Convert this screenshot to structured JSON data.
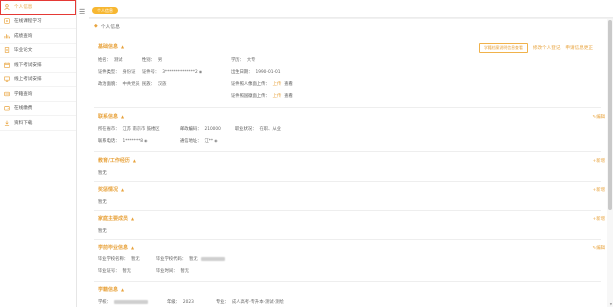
{
  "sidebar": {
    "items": [
      {
        "label": "个人信息",
        "icon": "person-icon"
      },
      {
        "label": "在线课程学习",
        "icon": "play-icon"
      },
      {
        "label": "成绩查询",
        "icon": "chart-icon"
      },
      {
        "label": "毕业论文",
        "icon": "document-icon"
      },
      {
        "label": "线下考试安排",
        "icon": "calendar-icon"
      },
      {
        "label": "线上考试安排",
        "icon": "monitor-icon"
      },
      {
        "label": "学籍查询",
        "icon": "id-card-icon"
      },
      {
        "label": "在线缴费",
        "icon": "wallet-icon"
      },
      {
        "label": "资料下载",
        "icon": "download-icon"
      }
    ]
  },
  "topbar": {
    "tag": "个人信息"
  },
  "breadcrumb": "个人信息",
  "actions": {
    "outline_btn": "学籍档案说明信息查看",
    "modify_personal": "修改个人登记",
    "apply_correction": "申请信息更正"
  },
  "basic": {
    "title": "基础信息",
    "name_label": "姓名：",
    "name_value": "测试",
    "gender_label": "性别：",
    "gender_value": "男",
    "edu_label": "学历：",
    "edu_value": "大专",
    "idtype_label": "证件类型：",
    "idtype_value": "身份证",
    "idno_label": "证件号：",
    "idno_value": "3**************2",
    "birth_label": "出生日期：",
    "birth_value": "1990-01-01",
    "politics_label": "政治面貌：",
    "politics_value": "中共党员",
    "nation_label": "民族：",
    "nation_value": "汉族",
    "front_label": "证件照人像面上传：",
    "back_label": "证件照国徽面上传：",
    "upload": "上传",
    "view": "查看"
  },
  "contact": {
    "title": "联系信息",
    "edit": "编辑",
    "city_label": "所在省市：",
    "city_value": "江苏 南京市 鼓楼区",
    "zip_label": "邮政编码：",
    "zip_value": "210000",
    "job_label": "职业状况：",
    "job_value": "在职、从业",
    "phone_label": "联系电话：",
    "phone_value": "1*******8",
    "addr_label": "通信地址：",
    "addr_value": "江**"
  },
  "education": {
    "title": "教育/工作经历",
    "add": "+新增",
    "empty": "暂无"
  },
  "awards": {
    "title": "奖惩情况",
    "add": "+新增",
    "empty": "暂无"
  },
  "family": {
    "title": "家庭主要成员",
    "add": "+新增",
    "empty": "暂无"
  },
  "graduation": {
    "title": "学前毕业信息",
    "edit": "编辑",
    "school_label": "毕业学校名称：",
    "school_value": "暂无",
    "code_label": "毕业学校代码：",
    "code_value": "暂无",
    "cert_label": "毕业证号：",
    "cert_value": "暂无",
    "time_label": "毕业时间：",
    "time_value": "暂无"
  },
  "status": {
    "title": "学籍信息",
    "school_label": "学校：",
    "year_label": "年级：",
    "year_value": "2023",
    "major_label": "专业：",
    "major_value": "成人高考-专升本-测试-测绘"
  }
}
